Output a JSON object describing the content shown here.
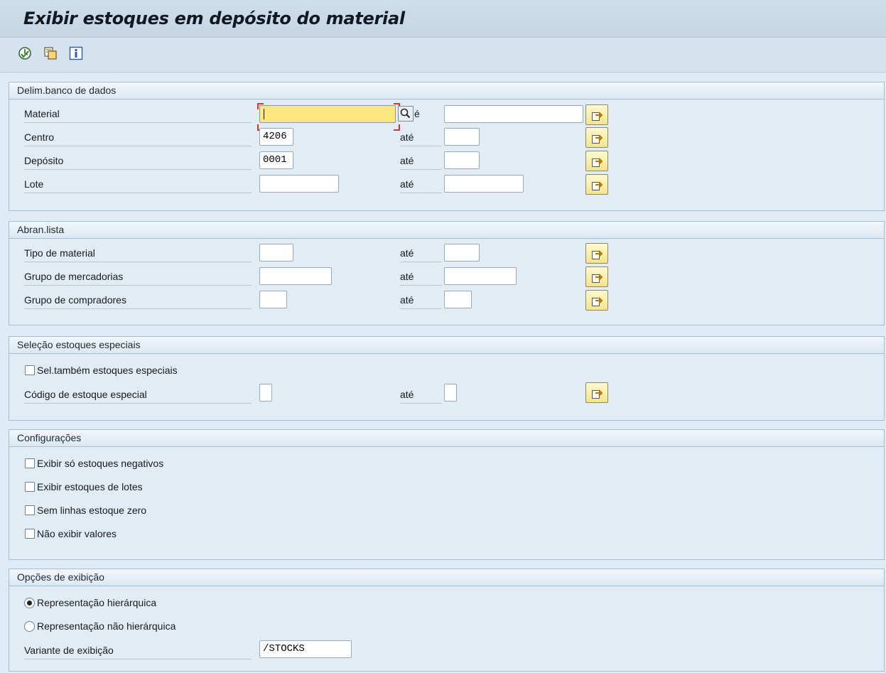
{
  "title": "Exibir estoques em depósito do material",
  "toolbar": {
    "icons": [
      "execute-icon",
      "copy-icon",
      "info-icon"
    ]
  },
  "colors": {
    "arrow_button": "#f4e48a",
    "focus_field": "#fde77f",
    "group_header": "#dce8f2"
  },
  "groups": {
    "db": {
      "header": "Delim.banco de dados",
      "material_label": "Material",
      "material_value": "",
      "material_to": "",
      "centro_label": "Centro",
      "centro_value": "4206",
      "centro_to": "",
      "deposito_label": "Depósito",
      "deposito_value": "0001",
      "deposito_to": "",
      "lote_label": "Lote",
      "lote_value": "",
      "lote_to": "",
      "ate": "até",
      "ate_partial": "é"
    },
    "list": {
      "header": "Abran.lista",
      "tipo_label": "Tipo de material",
      "grupo_merc_label": "Grupo de mercadorias",
      "grupo_comp_label": "Grupo de compradores",
      "ate": "até"
    },
    "special": {
      "header": "Seleção estoques especiais",
      "sel_label": "Sel.também estoques especiais",
      "codigo_label": "Código de estoque especial",
      "ate": "até"
    },
    "config": {
      "header": "Configurações",
      "opt1": "Exibir só estoques negativos",
      "opt2": "Exibir estoques de lotes",
      "opt3": "Sem linhas estoque zero",
      "opt4": "Não exibir valores"
    },
    "display": {
      "header": "Opções de exibição",
      "radio1": "Representação hierárquica",
      "radio2": "Representação não hierárquica",
      "selected_radio": 1,
      "variant_label": "Variante de exibição",
      "variant_value": "/STOCKS"
    }
  }
}
